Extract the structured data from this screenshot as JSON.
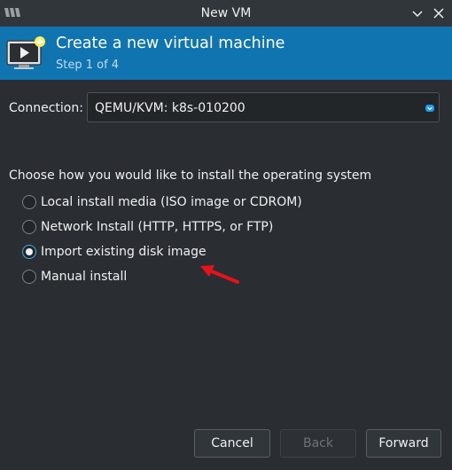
{
  "window": {
    "title": "New VM",
    "controls": [
      "chevron-down-icon",
      "close-icon"
    ]
  },
  "banner": {
    "title": "Create a new virtual machine",
    "step": "Step 1 of 4",
    "icon": "monitor-new-vm-icon",
    "background": "#0f74b0"
  },
  "connection": {
    "label": "Connection:",
    "value": "QEMU/KVM: k8s-010200"
  },
  "install": {
    "heading": "Choose how you would like to install the operating system",
    "options": [
      {
        "label": "Local install media (ISO image or CDROM)",
        "selected": false
      },
      {
        "label": "Network Install (HTTP, HTTPS, or FTP)",
        "selected": false
      },
      {
        "label": "Import existing disk image",
        "selected": true
      },
      {
        "label": "Manual install",
        "selected": false
      }
    ]
  },
  "annotation": {
    "icon": "red-arrow-icon",
    "color": "#e8131a"
  },
  "buttons": {
    "cancel": "Cancel",
    "back": "Back",
    "forward": "Forward"
  },
  "colors": {
    "accent": "#3daee9",
    "window_bg": "#2a2e32"
  }
}
